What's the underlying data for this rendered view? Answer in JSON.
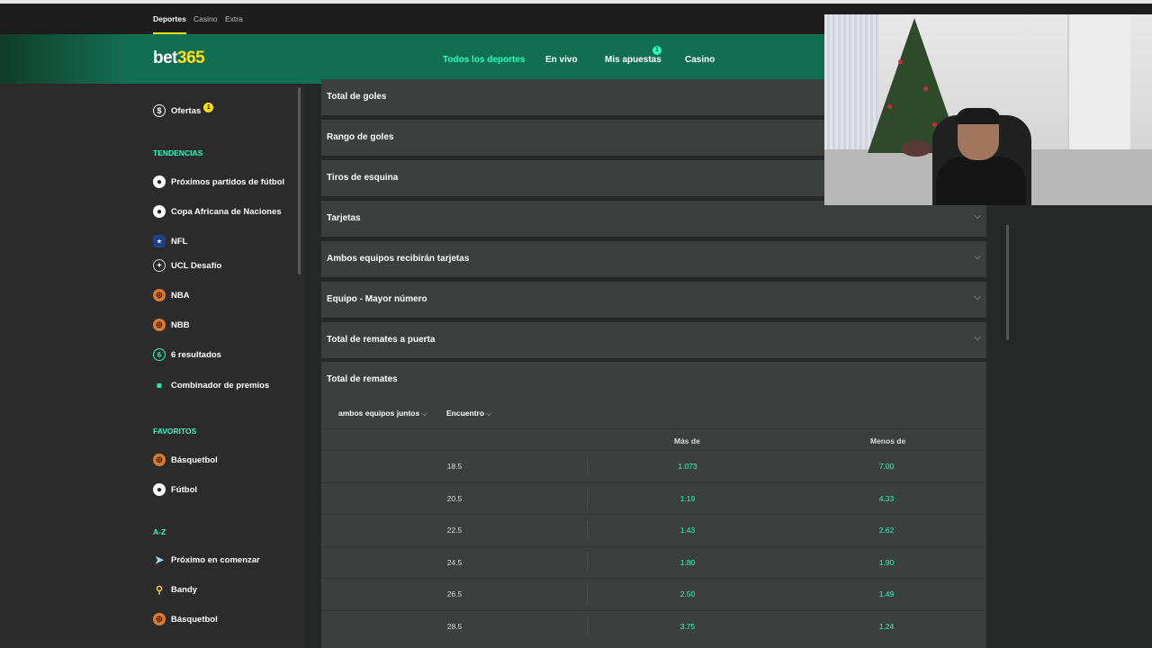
{
  "topbar": {
    "links": [
      "Deportes",
      "Casino",
      "Extra"
    ]
  },
  "header": {
    "logo_main": "bet",
    "logo_accent": "365",
    "nav": [
      "Todos los deportes",
      "En vivo",
      "Mis apuestas",
      "Casino"
    ],
    "bets_badge": "1"
  },
  "sidebar": {
    "ofertas": {
      "label": "Ofertas",
      "badge": "1"
    },
    "tendencias_heading": "TENDENCIAS",
    "tendencias": [
      {
        "label": "Próximos partidos de fútbol",
        "icon": "soccer-ball-icon"
      },
      {
        "label": "Copa Africana de Naciones",
        "icon": "soccer-ball-icon"
      },
      {
        "label": "NFL",
        "icon": "nfl-shield-icon"
      },
      {
        "label": "UCL Desafío",
        "icon": "ucl-star-ball-icon"
      },
      {
        "label": "NBA",
        "icon": "basketball-icon"
      },
      {
        "label": "NBB",
        "icon": "basketball-icon"
      },
      {
        "label": "6 resultados",
        "icon": "six-results-icon"
      },
      {
        "label": "Combinador de premios",
        "icon": "prizes-icon"
      }
    ],
    "favoritos_heading": "FAVORITOS",
    "favoritos": [
      {
        "label": "Básquetbol",
        "icon": "basketball-icon"
      },
      {
        "label": "Fútbol",
        "icon": "soccer-ball-icon"
      }
    ],
    "az_heading": "A-Z",
    "az": [
      {
        "label": "Próximo en comenzar",
        "icon": "arrow-right-icon"
      },
      {
        "label": "Bandy",
        "icon": "bandy-icon"
      },
      {
        "label": "Básquetbol",
        "icon": "basketball-icon"
      }
    ]
  },
  "markets": [
    "Total de goles",
    "Rango de goles",
    "Tiros de esquina",
    "Tarjetas",
    "Ambos equipos recibirán tarjetas",
    "Equipo - Mayor número",
    "Total de remates a puerta"
  ],
  "total_remates": {
    "title": "Total de remates",
    "filter_teams": "ambos equipos juntos",
    "filter_period": "Encuentro",
    "col_over": "Más de",
    "col_under": "Menos de",
    "rows": [
      {
        "line": "18.5",
        "over": "1.073",
        "under": "7.00"
      },
      {
        "line": "20.5",
        "over": "1.19",
        "under": "4.33"
      },
      {
        "line": "22.5",
        "over": "1.43",
        "under": "2.62"
      },
      {
        "line": "24.5",
        "over": "1.80",
        "under": "1.90"
      },
      {
        "line": "26.5",
        "over": "2.50",
        "under": "1.49"
      },
      {
        "line": "28.5",
        "over": "3.75",
        "under": "1.24"
      }
    ]
  },
  "colors": {
    "brand_green": "#126e51",
    "accent_green": "#26ffbe",
    "accent_yellow": "#ffdf1b",
    "panel": "#3b3f3d"
  }
}
